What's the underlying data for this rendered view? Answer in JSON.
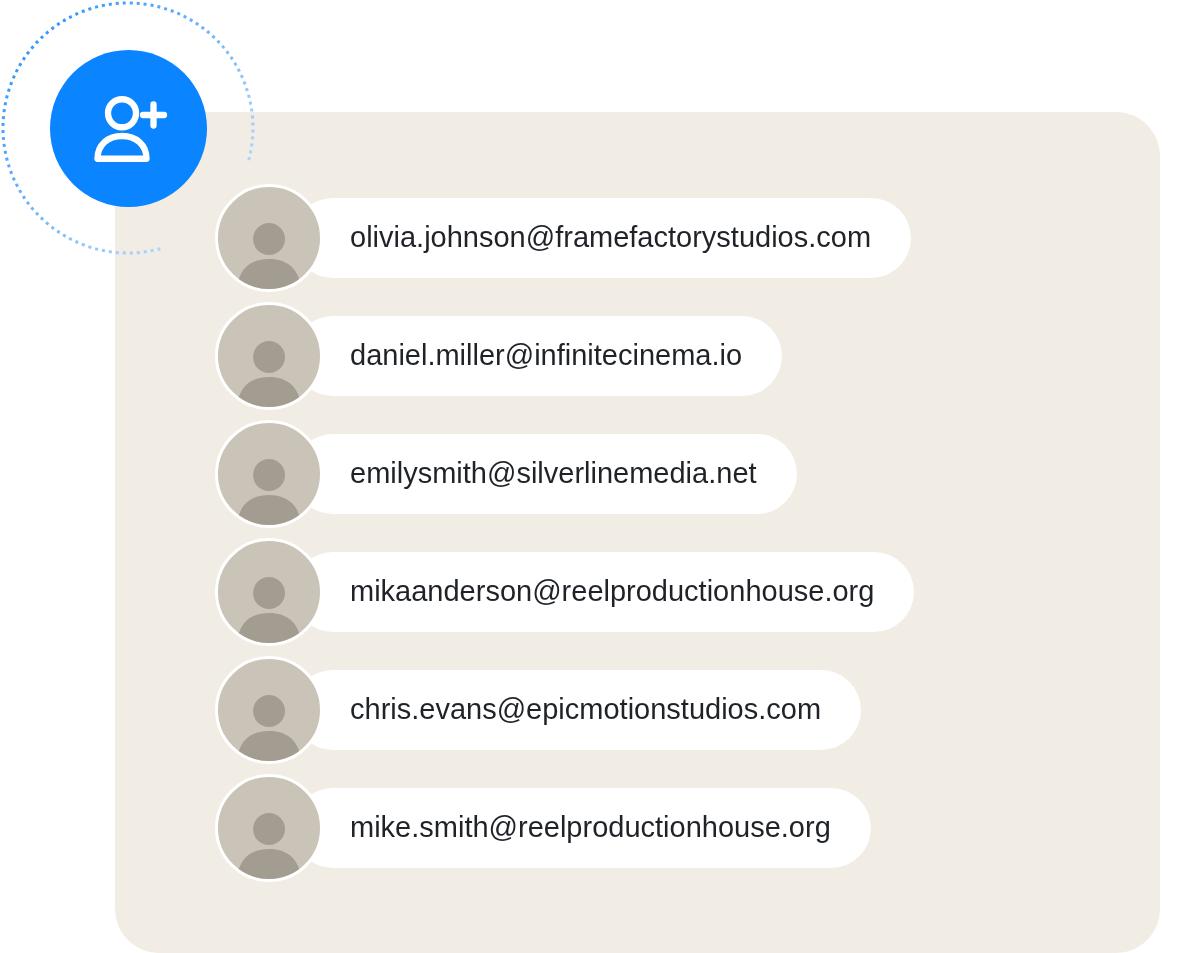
{
  "contacts": [
    {
      "email": "olivia.johnson@framefactorystudios.com"
    },
    {
      "email": "daniel.miller@infinitecinema.io"
    },
    {
      "email": "emilysmith@silverlinemedia.net"
    },
    {
      "email": "mikaanderson@reelproductionhouse.org"
    },
    {
      "email": "chris.evans@epicmotionstudios.com"
    },
    {
      "email": "mike.smith@reelproductionhouse.org"
    }
  ]
}
